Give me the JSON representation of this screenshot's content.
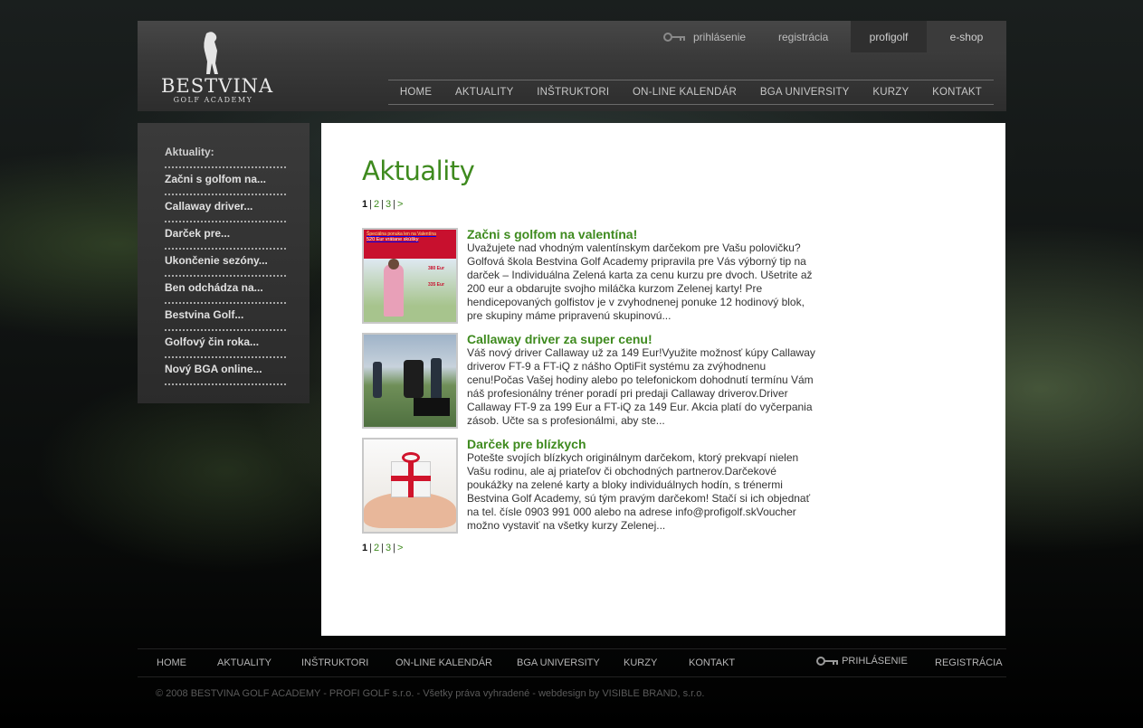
{
  "header": {
    "logo_main": "BESTVINA",
    "logo_sub": "GOLF ACADEMY",
    "top_links": {
      "login": "prihlásenie",
      "register": "registrácia",
      "profigolf": "profigolf",
      "eshop": "e-shop"
    },
    "nav": [
      "HOME",
      "AKTUALITY",
      "INŠTRUKTORI",
      "ON-LINE KALENDÁR",
      "BGA UNIVERSITY",
      "KURZY",
      "KONTAKT"
    ]
  },
  "sidebar": {
    "heading": "Aktuality:",
    "items": [
      "Začni s golfom na...",
      "Callaway driver...",
      "Darček pre...",
      "Ukončenie sezóny...",
      "Ben odchádza na...",
      "Bestvina Golf...",
      "Golfový čin roka...",
      "Nový BGA online..."
    ]
  },
  "content": {
    "title": "Aktuality",
    "pager": {
      "current": "1",
      "pages": [
        "2",
        "3"
      ],
      "next": ">"
    },
    "news": [
      {
        "title": "Začni s golfom na valentína!",
        "excerpt": "Uvažujete nad vhodným valentínskym darčekom pre Vašu polovičku? Golfová škola Bestvina Golf Academy pripravila pre Vás výborný tip na darček – Individuálna Zelená karta za cenu kurzu pre dvoch. Ušetrite až 200 eur a obdarujte svojho miláčka kurzom Zelenej karty! Pre hendicepovaných golfistov je v zvyhodnenej ponuke 12 hodinový blok, pre skupiny máme pripravenú skupinovú...",
        "thumb_texts": [
          "Špeciálna ponuka len na Valentína",
          "520 Eur vrátane skúšky",
          "380 Eur",
          "335 Eur"
        ]
      },
      {
        "title": "Callaway driver za super cenu!",
        "excerpt": "Váš nový driver Callaway už za 149 Eur!Využite možnosť kúpy Callaway driverov FT-9 a FT-iQ z nášho OptiFit systému za zvýhodnenu cenu!Počas Vašej hodiny alebo po telefonickom dohodnutí termínu Vám náš profesionálny tréner poradí pri predaji Callaway driverov.Driver Callaway FT-9 za 199 Eur a FT-iQ za 149 Eur. Akcia platí do vyčerpania zásob. Učte sa s profesionálmi, aby ste..."
      },
      {
        "title": "Darček pre blízkych",
        "excerpt": "Potešte svojích blízkych originálnym darčekom, ktorý prekvapí nielen Vašu rodinu, ale aj priateľov či obchodných partnerov.Darčekové poukážky na zelené karty a bloky individuálnych hodín, s trénermi Bestvina Golf Academy, sú tým pravým darčekom! Stačí si ich objednať na tel. čísle 0903 991 000 alebo na adrese info@profigolf.skVoucher možno vystaviť na všetky kurzy Zelenej..."
      }
    ]
  },
  "footer": {
    "nav": [
      "HOME",
      "AKTUALITY",
      "INŠTRUKTORI",
      "ON-LINE KALENDÁR",
      "BGA UNIVERSITY",
      "KURZY",
      "KONTAKT"
    ],
    "login": "PRIHLÁSENIE",
    "register": "REGISTRÁCIA",
    "copyright": "© 2008 BESTVINA GOLF ACADEMY - PROFI GOLF s.r.o. - Všetky práva vyhradené - webdesign by VISIBLE BRAND, s.r.o."
  },
  "colors": {
    "accent_green": "#3e8a1e",
    "header_gray": "#3a3a3a"
  }
}
